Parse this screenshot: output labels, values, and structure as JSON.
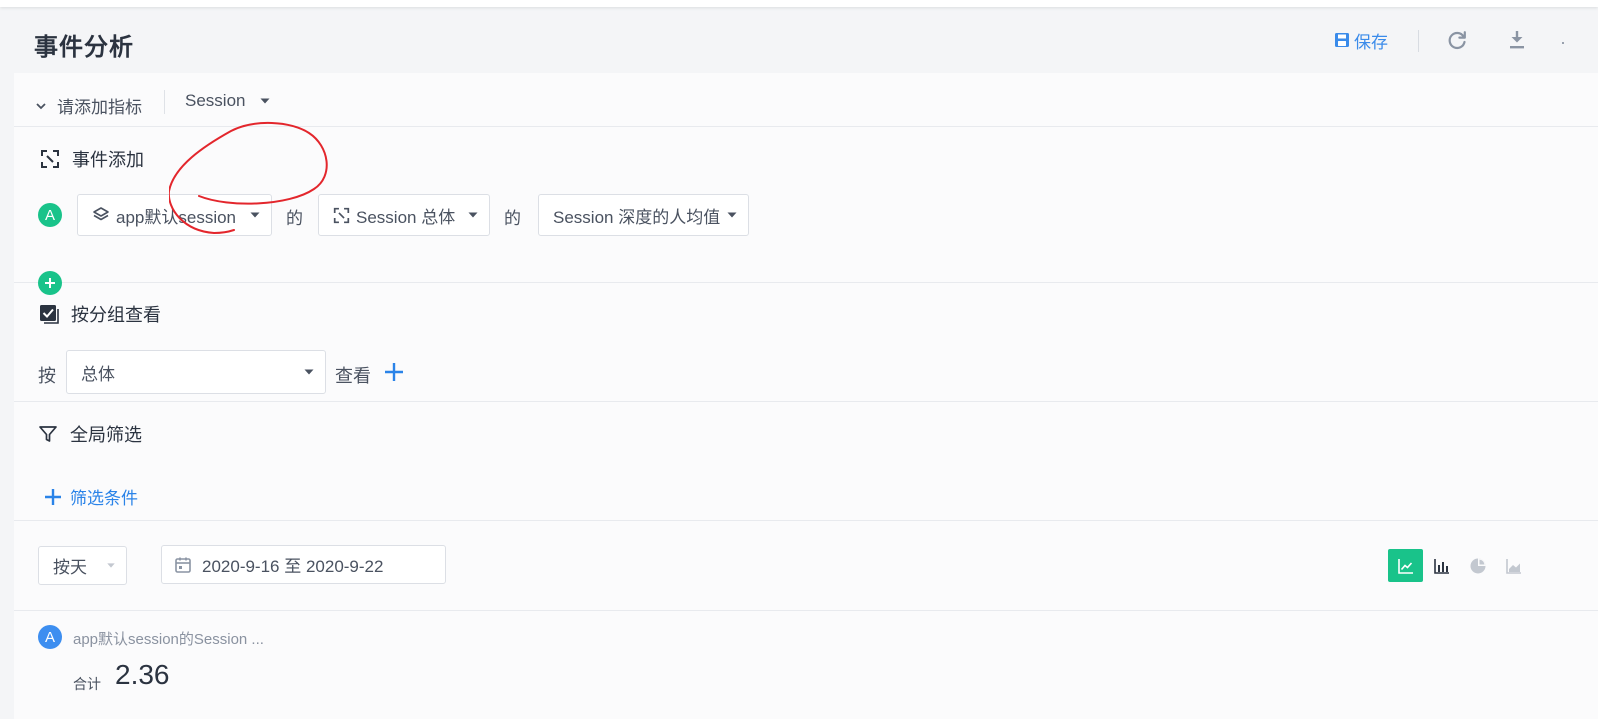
{
  "header": {
    "title": "事件分析",
    "save_label": "保存"
  },
  "metric_bar": {
    "toggle_label": "请添加指标",
    "metric_type": "Session"
  },
  "event_section": {
    "title": "事件添加",
    "rows": [
      {
        "badge": "A",
        "session_source": "app默认session",
        "connector1": "的",
        "event": "Session 总体",
        "connector2": "的",
        "measure": "Session 深度的人均值"
      }
    ]
  },
  "group_section": {
    "title": "按分组查看",
    "prefix": "按",
    "group_value": "总体",
    "suffix": "查看"
  },
  "filter_section": {
    "title": "全局筛选",
    "add_label": "筛选条件"
  },
  "controls": {
    "granularity": "按天",
    "date_range": "2020-9-16 至 2020-9-22",
    "chart_types": [
      "line-chart-icon",
      "bar-chart-icon",
      "pie-chart-icon",
      "area-chart-icon"
    ],
    "active_chart": "line-chart-icon"
  },
  "result": {
    "badge": "A",
    "series_label": "app默认session的Session ...",
    "total_label": "合计",
    "total_value": "2.36"
  },
  "colors": {
    "accent_green": "#19c38a",
    "accent_blue": "#2a83e8",
    "annotation_red": "#e3262c"
  }
}
